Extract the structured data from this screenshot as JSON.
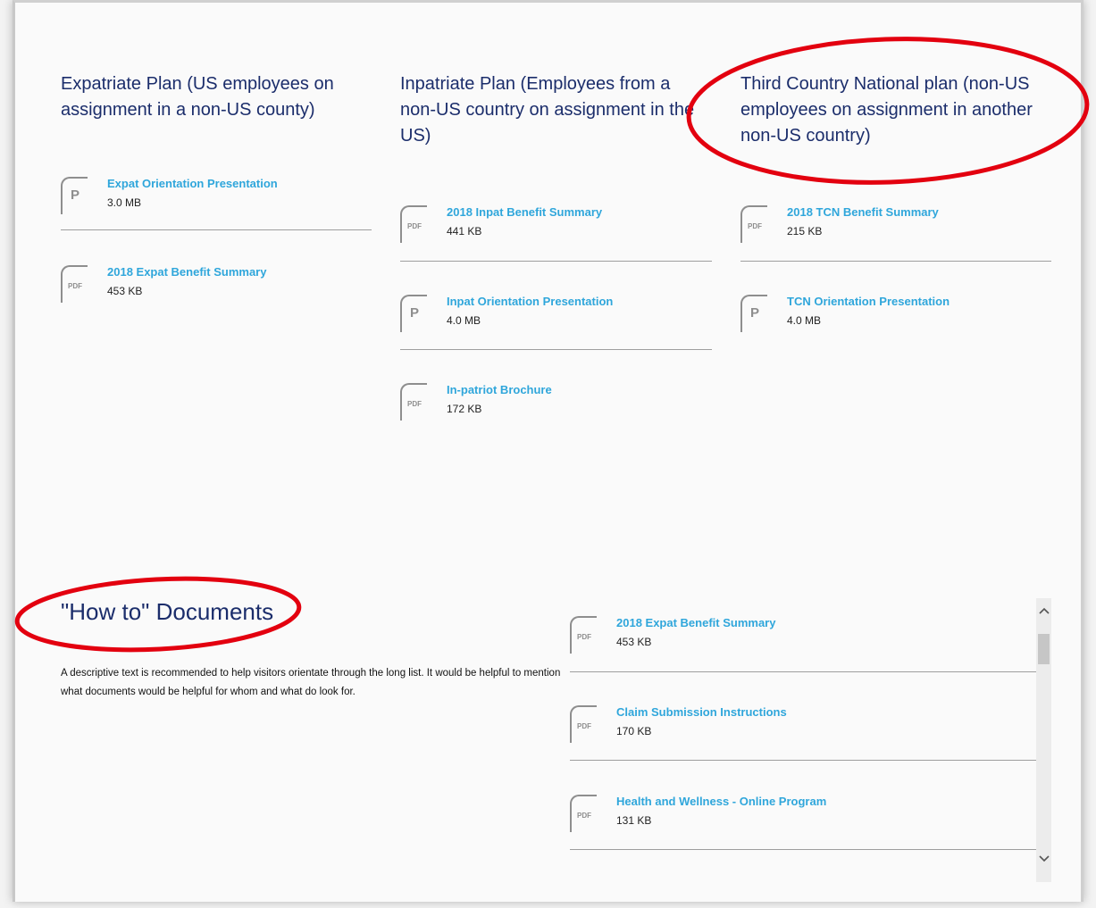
{
  "plans": {
    "expat": {
      "title": "Expatriate Plan (US employees on assignment in a non-US county)",
      "docs": [
        {
          "name": "Expat Orientation Presentation",
          "size": "3.0 MB",
          "icon": "P"
        },
        {
          "name": "2018 Expat Benefit Summary",
          "size": "453 KB",
          "icon": "PDF"
        }
      ]
    },
    "inpat": {
      "title": "Inpatriate Plan (Employees from a non-US country on assignment in the US)",
      "docs": [
        {
          "name": "2018 Inpat Benefit Summary",
          "size": "441 KB",
          "icon": "PDF"
        },
        {
          "name": "Inpat Orientation Presentation",
          "size": "4.0 MB",
          "icon": "P"
        },
        {
          "name": "In-patriot Brochure",
          "size": "172 KB",
          "icon": "PDF"
        }
      ]
    },
    "tcn": {
      "title": "Third Country National plan (non-US employees on assignment in another non-US country)",
      "docs": [
        {
          "name": "2018 TCN Benefit Summary",
          "size": "215 KB",
          "icon": "PDF"
        },
        {
          "name": "TCN Orientation Presentation",
          "size": "4.0 MB",
          "icon": "P"
        }
      ]
    }
  },
  "howto": {
    "title": "\"How to\" Documents",
    "description": "A descriptive text is recommended to help visitors orientate through the long list. It would be helpful to mention what documents would be helpful for whom and what do look for.",
    "docs": [
      {
        "name": "2018 Expat Benefit Summary",
        "size": "453 KB",
        "icon": "PDF"
      },
      {
        "name": "Claim Submission Instructions",
        "size": "170 KB",
        "icon": "PDF"
      },
      {
        "name": "Health and Wellness - Online Program",
        "size": "131 KB",
        "icon": "PDF"
      }
    ]
  },
  "scroll": {
    "up": "^",
    "down": "v"
  },
  "colors": {
    "title": "#1b2d6b",
    "link": "#2fa6db",
    "annotation": "#e3000f"
  }
}
